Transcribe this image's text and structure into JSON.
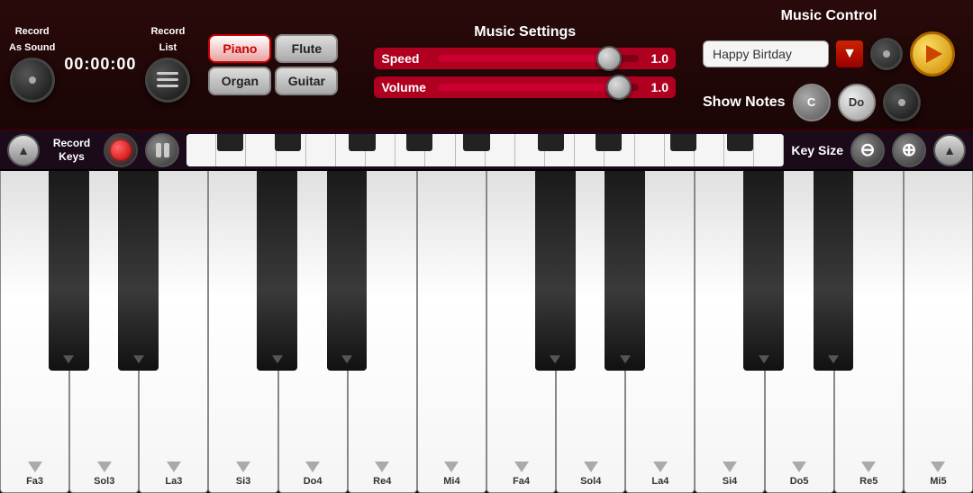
{
  "topBar": {
    "recordAsSound": {
      "line1": "Record",
      "line2": "As Sound"
    },
    "timer": "00:00:00",
    "recordList": {
      "line1": "Record",
      "line2": "List"
    },
    "instruments": [
      "Piano",
      "Flute",
      "Organ",
      "Guitar"
    ],
    "activeInstrument": "Piano",
    "musicSettings": {
      "title": "Music Settings",
      "speed": {
        "label": "Speed",
        "value": "1.0",
        "fillPercent": 85
      },
      "volume": {
        "label": "Volume",
        "value": "1.0",
        "fillPercent": 90
      }
    },
    "musicControl": {
      "title": "Music Control",
      "songName": "Happy Birtday",
      "showNotes": "Show Notes",
      "noteButtons": [
        "C",
        "Do"
      ]
    }
  },
  "middleBar": {
    "recordKeys": "Record\nKeys",
    "keySize": "Key Size"
  },
  "piano": {
    "whiteKeys": [
      {
        "label": "Fa3"
      },
      {
        "label": "Sol3"
      },
      {
        "label": "La3"
      },
      {
        "label": "Si3"
      },
      {
        "label": "Do4"
      },
      {
        "label": "Re4"
      },
      {
        "label": "Mi4"
      },
      {
        "label": "Fa4"
      },
      {
        "label": "Sol4"
      },
      {
        "label": "La4"
      },
      {
        "label": "Si4"
      },
      {
        "label": "Do5"
      },
      {
        "label": "Re5"
      },
      {
        "label": "Mi5"
      }
    ]
  }
}
